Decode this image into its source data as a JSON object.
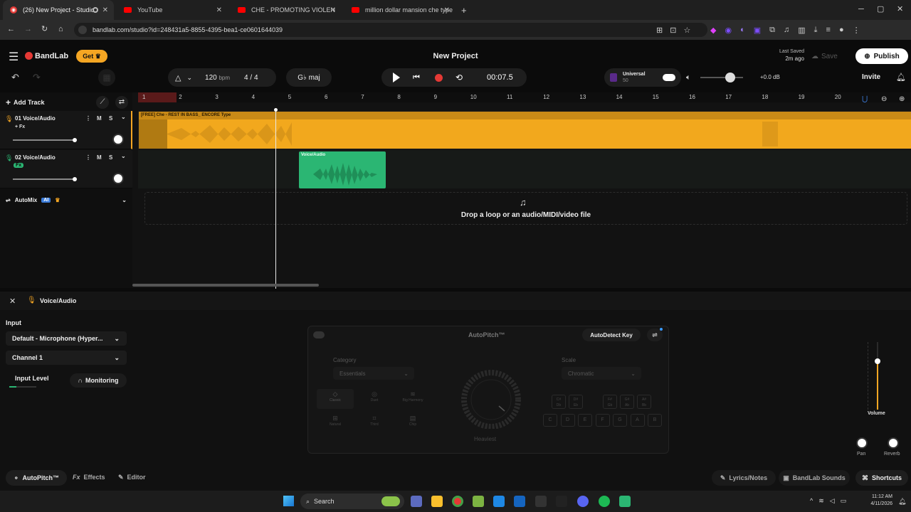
{
  "browser": {
    "tabs": [
      {
        "label": "(26) New Project - Studio"
      },
      {
        "label": "YouTube"
      },
      {
        "label": "CHE - PROMOTING VIOLEN"
      },
      {
        "label": "million dollar mansion che type"
      }
    ],
    "url": "bandlab.com/studio?id=248431a5-8855-4395-bea1-ce0601644039"
  },
  "header": {
    "brand": "BandLab",
    "get_label": "Get",
    "project_title": "New Project",
    "last_saved_label": "Last Saved",
    "last_saved_time": "2m ago",
    "save_label": "Save",
    "publish_label": "Publish",
    "invite_label": "Invite"
  },
  "transport": {
    "tempo": "120",
    "tempo_unit": "bpm",
    "time_signature": "4 / 4",
    "key": "G♭ maj",
    "time": "00:07.5",
    "preset_name": "Universal",
    "preset_value": "50",
    "gain": "+0.0 dB"
  },
  "tracks_panel": {
    "add_track_label": "Add Track",
    "tracks": [
      {
        "name": "01 Voice/Audio",
        "fx": "+ Fx",
        "m": "M",
        "s": "S"
      },
      {
        "name": "02 Voice/Audio",
        "fx": "Fx",
        "m": "M",
        "s": "S"
      }
    ],
    "automix_label": "AutoMix",
    "ai_badge": "AI"
  },
  "ruler": [
    "1",
    "2",
    "3",
    "4",
    "5",
    "6",
    "7",
    "8",
    "9",
    "10",
    "11",
    "12",
    "13",
    "14",
    "15",
    "16",
    "17",
    "18",
    "19",
    "20"
  ],
  "clips": {
    "clip1_label": "[FREE] Che - REST IN BASS_ ENCORE Type",
    "clip2_label": "Voice/Audio",
    "drop_text": "Drop a loop or an audio/MIDI/video file"
  },
  "bottom": {
    "panel_title": "Voice/Audio",
    "input_label": "Input",
    "input_device": "Default - Microphone (Hyper...",
    "channel": "Channel 1",
    "input_level_label": "Input Level",
    "monitoring_label": "Monitoring",
    "autopitch": {
      "title": "AutoPitch™",
      "autodetect_label": "AutoDetect Key",
      "category_label": "Category",
      "category_value": "Essentials",
      "scale_label": "Scale",
      "scale_value": "Chromatic",
      "knob_label": "Heaviest",
      "presets": [
        "Classic",
        "Duet",
        "Big Harmony",
        "Natural",
        "Third",
        "Chip"
      ],
      "sharp_keys": [
        [
          "C#",
          "Db"
        ],
        [
          "D#",
          "Eb"
        ],
        [
          "F#",
          "Gb"
        ],
        [
          "G#",
          "Ab"
        ],
        [
          "A#",
          "Bb"
        ]
      ],
      "natural_keys": [
        "C",
        "D",
        "E",
        "F",
        "G",
        "A",
        "B"
      ]
    },
    "volume_label": "Volume",
    "pan_label": "Pan",
    "reverb_label": "Reverb",
    "tabs": {
      "autopitch": "AutoPitch™",
      "effects": "Effects",
      "editor": "Editor",
      "fx_prefix": "Fx"
    },
    "right_tabs": {
      "lyrics": "Lyrics/Notes",
      "sounds": "BandLab Sounds",
      "shortcuts": "Shortcuts"
    }
  },
  "taskbar": {
    "search_placeholder": "Search",
    "time": "11:12 AM",
    "date": "4/11/2026"
  },
  "colors": {
    "accent_orange": "#f5a623",
    "clip_orange": "#f2a81d",
    "clip_green": "#2bb673",
    "record_red": "#e53935"
  }
}
